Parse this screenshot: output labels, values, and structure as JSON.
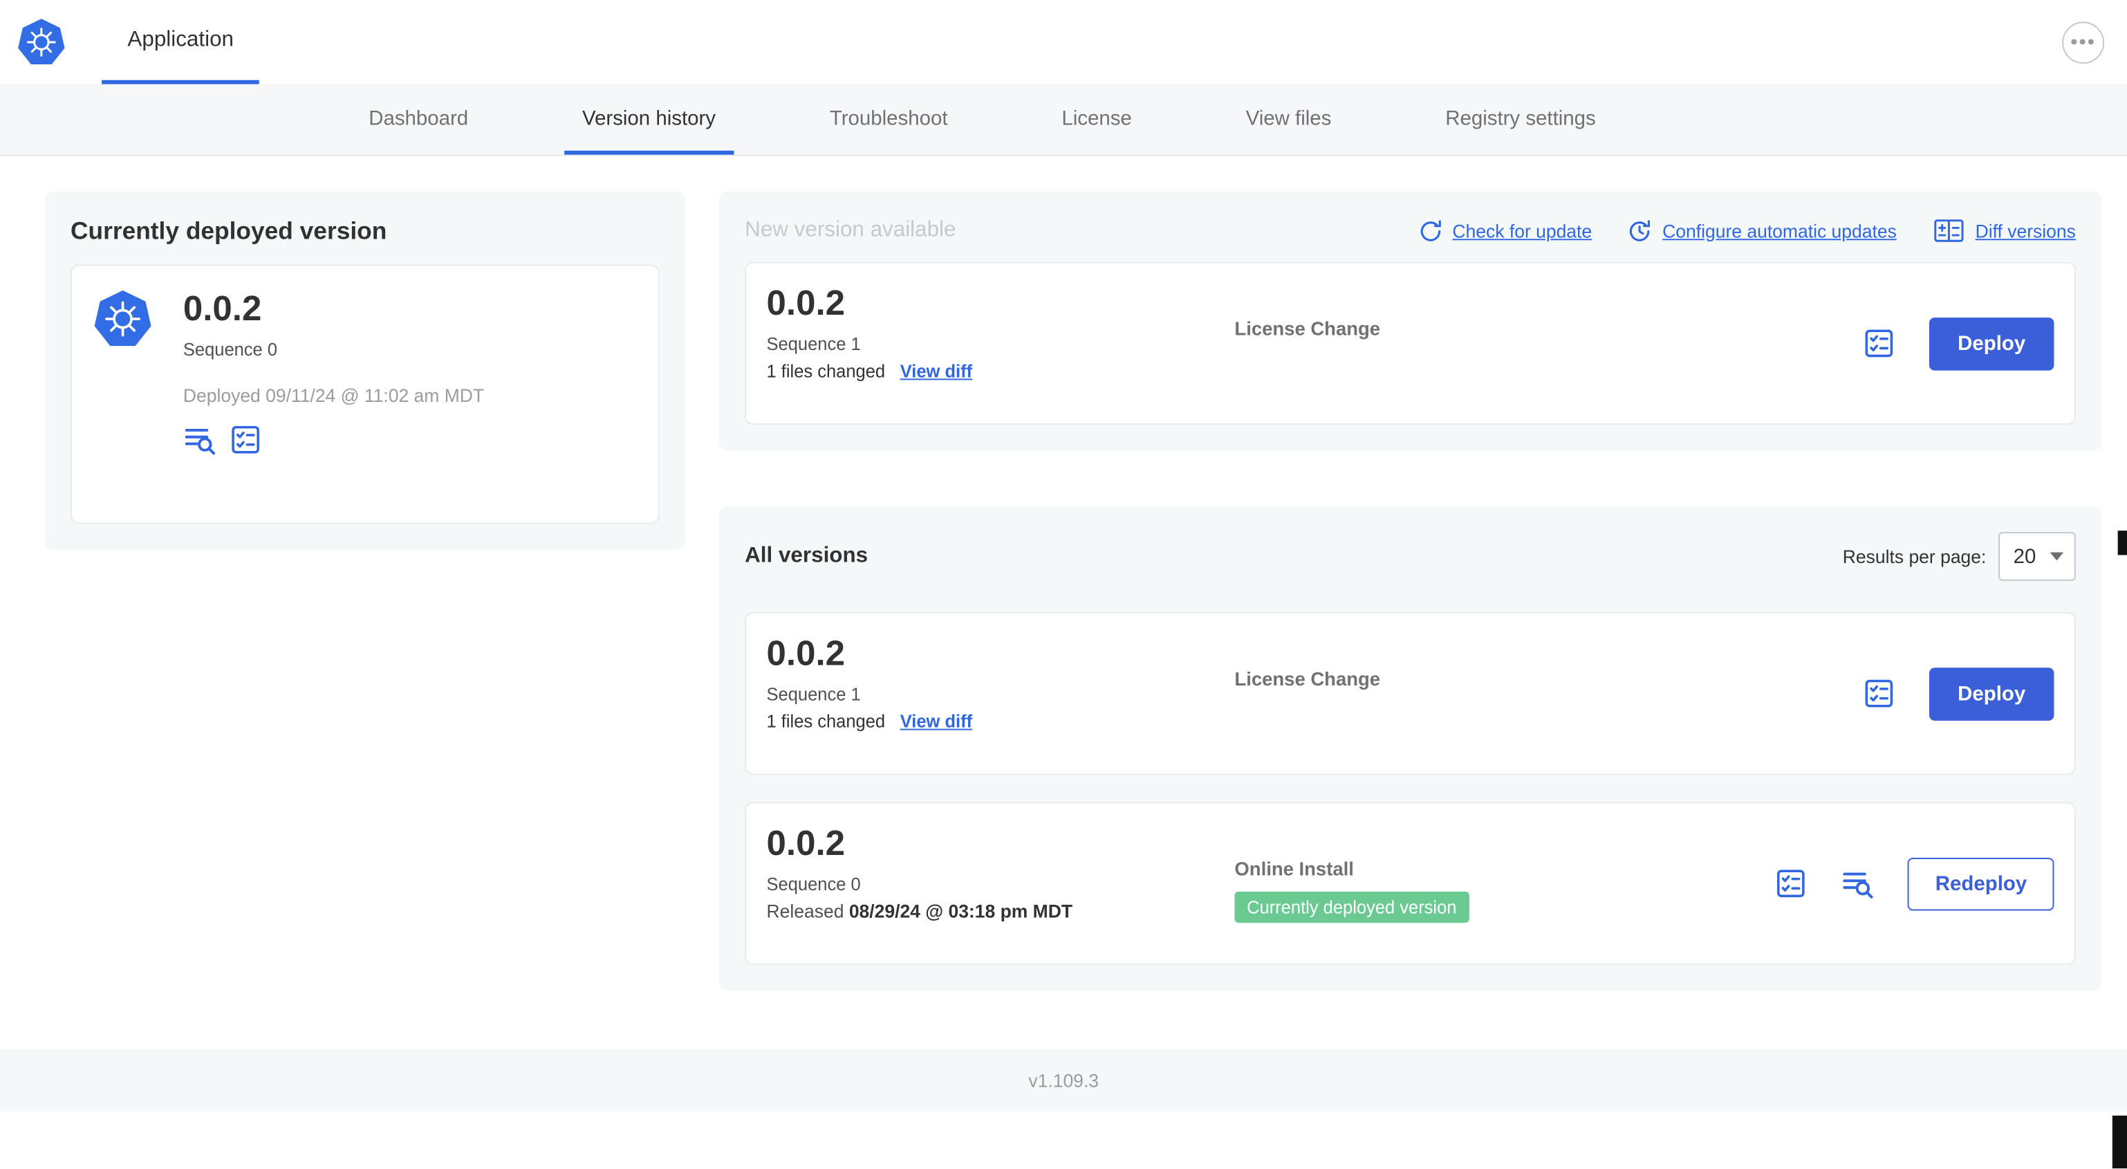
{
  "header": {
    "app_tab_label": "Application"
  },
  "nav": {
    "active_tab": "Version history",
    "tabs": [
      {
        "label": "Dashboard"
      },
      {
        "label": "Version history"
      },
      {
        "label": "Troubleshoot"
      },
      {
        "label": "License"
      },
      {
        "label": "View files"
      },
      {
        "label": "Registry settings"
      }
    ]
  },
  "current_version": {
    "title": "Currently deployed version",
    "version": "0.0.2",
    "sequence": "Sequence 0",
    "deployed": "Deployed 09/11/24 @ 11:02 am MDT"
  },
  "new_version": {
    "title": "New version available",
    "check_for_update": "Check for update",
    "configure_auto_updates": "Configure automatic updates",
    "diff_versions": "Diff versions",
    "card": {
      "version": "0.0.2",
      "sequence": "Sequence 1",
      "files_changed": "1 files changed",
      "view_diff": "View diff",
      "source": "License Change",
      "deploy": "Deploy"
    }
  },
  "all_versions": {
    "title": "All versions",
    "results_per_page_label": "Results per page:",
    "results_per_page": "20",
    "rows": [
      {
        "version": "0.0.2",
        "sequence": "Sequence 1",
        "files_changed": "1 files changed",
        "view_diff": "View diff",
        "source": "License Change",
        "action": "Deploy"
      },
      {
        "version": "0.0.2",
        "sequence": "Sequence 0",
        "released_prefix": "Released ",
        "released_date": "08/29/24 @ 03:18 pm MDT",
        "source": "Online Install",
        "badge": "Currently deployed version",
        "action": "Redeploy"
      }
    ]
  },
  "footer": {
    "version": "v1.109.3"
  },
  "icons": {
    "kubernetes_logo": "blue heptagon with white helm wheel",
    "ellipsis_icon": "⋯",
    "check_update_icon": "circular refresh arrow",
    "auto_update_icon": "clock with refresh arrow",
    "diff_versions_icon": "split table with plus/minus",
    "release_notes_icon": "text lines with magnifier",
    "checklist_icon": "bordered square with checked list"
  },
  "colors": {
    "accent_blue": "#3066e0",
    "button_blue": "#3b5fd9",
    "k8s_blue": "#326de6",
    "badge_green": "#6aca92",
    "panel_bg": "#f5f8f9",
    "muted_text": "#9b9b9b",
    "faint_title": "#c6c9cc",
    "dark_text": "#323232"
  }
}
